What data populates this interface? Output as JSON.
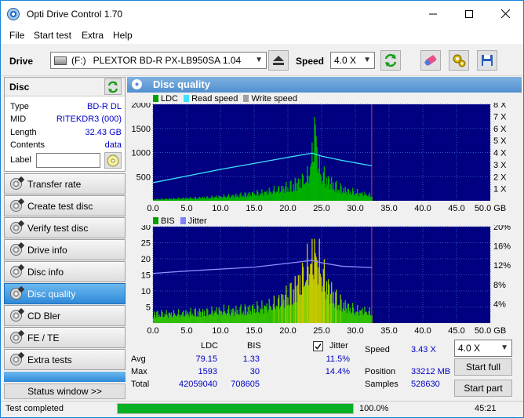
{
  "window": {
    "title": "Opti Drive Control 1.70"
  },
  "menu": [
    "File",
    "Start test",
    "Extra",
    "Help"
  ],
  "toolbar": {
    "drive_label": "Drive",
    "drive_letter": "(F:)",
    "drive_name": "PLEXTOR BD-R  PX-LB950SA 1.04",
    "speed_label": "Speed",
    "speed_value": "4.0 X"
  },
  "disc": {
    "header": "Disc",
    "rows": [
      {
        "label": "Type",
        "value": "BD-R DL"
      },
      {
        "label": "MID",
        "value": "RITEKDR3 (000)"
      },
      {
        "label": "Length",
        "value": "32.43 GB"
      },
      {
        "label": "Contents",
        "value": "data"
      }
    ],
    "label_field_label": "Label",
    "label_value": ""
  },
  "sidebar": {
    "items": [
      {
        "label": "Transfer rate",
        "active": false
      },
      {
        "label": "Create test disc",
        "active": false
      },
      {
        "label": "Verify test disc",
        "active": false
      },
      {
        "label": "Drive info",
        "active": false
      },
      {
        "label": "Disc info",
        "active": false
      },
      {
        "label": "Disc quality",
        "active": true
      },
      {
        "label": "CD Bler",
        "active": false
      },
      {
        "label": "FE / TE",
        "active": false
      },
      {
        "label": "Extra tests",
        "active": false
      }
    ],
    "status_window": "Status window >>"
  },
  "main": {
    "title": "Disc quality",
    "legend_top": [
      {
        "name": "LDC",
        "color": "#00a000"
      },
      {
        "name": "Read speed",
        "color": "#40e0ff"
      },
      {
        "name": "Write speed",
        "color": "#a0a0a0"
      }
    ],
    "legend_bottom": [
      {
        "name": "BIS",
        "color": "#00a000"
      },
      {
        "name": "Jitter",
        "color": "#8080ff"
      }
    ]
  },
  "chart_data": [
    {
      "type": "area",
      "x_ticks": [
        "0.0",
        "5.0",
        "10.0",
        "15.0",
        "20.0",
        "25.0",
        "30.0",
        "35.0",
        "40.0",
        "45.0",
        "50.0 GB"
      ],
      "xlim": [
        0,
        50
      ],
      "y_ticks_left": [
        "2000",
        "1500",
        "1000",
        "500"
      ],
      "ylim_left": [
        0,
        2000
      ],
      "y_ticks_right": [
        "8 X",
        "7 X",
        "6 X",
        "5 X",
        "4 X",
        "3 X",
        "2 X",
        "1 X"
      ],
      "ylim_right": [
        0,
        8
      ],
      "series": [
        {
          "name": "LDC",
          "x": [
            0,
            2,
            4,
            6,
            8,
            10,
            12,
            14,
            16,
            18,
            20,
            21,
            22,
            23,
            23.5,
            24,
            24.5,
            25,
            26,
            27,
            28,
            29,
            30,
            31,
            32,
            32.43
          ],
          "values": [
            30,
            40,
            50,
            60,
            70,
            90,
            110,
            140,
            170,
            220,
            300,
            360,
            420,
            520,
            900,
            1593,
            700,
            560,
            420,
            320,
            250,
            200,
            180,
            150,
            120,
            100
          ]
        },
        {
          "name": "Read speed",
          "x": [
            0,
            5,
            10,
            15,
            20,
            23.6,
            25,
            28,
            32.43
          ],
          "values": [
            1.5,
            2.05,
            2.6,
            3.1,
            3.6,
            3.95,
            3.7,
            3.35,
            2.9
          ]
        }
      ]
    },
    {
      "type": "area",
      "x_ticks": [
        "0.0",
        "5.0",
        "10.0",
        "15.0",
        "20.0",
        "25.0",
        "30.0",
        "35.0",
        "40.0",
        "45.0",
        "50.0 GB"
      ],
      "xlim": [
        0,
        50
      ],
      "y_ticks_left": [
        "30",
        "25",
        "20",
        "15",
        "10",
        "5"
      ],
      "ylim_left": [
        0,
        30
      ],
      "y_ticks_right": [
        "20%",
        "16%",
        "12%",
        "8%",
        "4%"
      ],
      "ylim_right": [
        0,
        20
      ],
      "series": [
        {
          "name": "BIS",
          "x": [
            0,
            2,
            4,
            6,
            8,
            10,
            12,
            14,
            16,
            18,
            20,
            21,
            22,
            23,
            24,
            25,
            26,
            27,
            28,
            29,
            30,
            31,
            32,
            32.43
          ],
          "values": [
            3,
            3,
            3,
            3.5,
            3.5,
            4,
            4,
            4.5,
            5,
            6,
            9,
            11,
            14,
            18,
            22,
            16,
            11,
            8,
            6,
            5,
            4,
            4,
            3.5,
            3
          ]
        },
        {
          "name": "Jitter",
          "x": [
            0,
            5,
            10,
            15,
            20,
            23.5,
            25,
            28,
            32.43
          ],
          "values": [
            10.3,
            10.8,
            11.2,
            11.6,
            12.4,
            13.0,
            12.5,
            11.8,
            11.5
          ]
        }
      ]
    }
  ],
  "stats": {
    "col_ldc": "LDC",
    "col_bis": "BIS",
    "jitter_label": "Jitter",
    "rows": [
      {
        "label": "Avg",
        "ldc": "79.15",
        "bis": "1.33",
        "jitter": "11.5%"
      },
      {
        "label": "Max",
        "ldc": "1593",
        "bis": "30",
        "jitter": "14.4%"
      },
      {
        "label": "Total",
        "ldc": "42059040",
        "bis": "708605",
        "jitter": ""
      }
    ],
    "speed_label": "Speed",
    "speed_value": "3.43 X",
    "position_label": "Position",
    "position_value": "33212 MB",
    "samples_label": "Samples",
    "samples_value": "528630",
    "speed_select": "4.0 X",
    "start_full": "Start full",
    "start_part": "Start part"
  },
  "status": {
    "text": "Test completed",
    "progress": 100,
    "progress_text": "100.0%",
    "time": "45:21"
  }
}
